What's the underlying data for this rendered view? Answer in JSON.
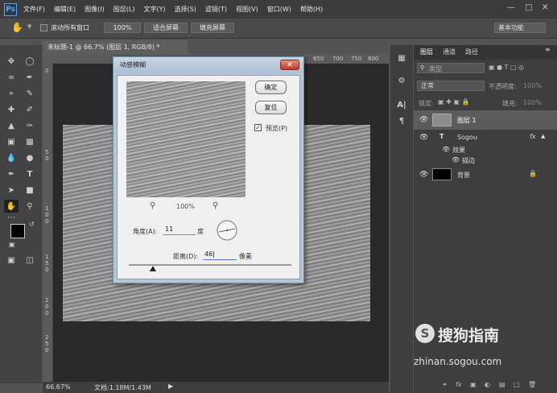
{
  "app": {
    "logo": "Ps"
  },
  "menu": [
    "文件(F)",
    "编辑(E)",
    "图像(I)",
    "图层(L)",
    "文字(Y)",
    "选择(S)",
    "滤镜(T)",
    "视图(V)",
    "窗口(W)",
    "帮助(H)"
  ],
  "options": {
    "scroll_all_label": "滚动所有窗口",
    "zoom_value": "100%",
    "fit_screen": "适合屏幕",
    "fill_screen": "填充屏幕",
    "workspace": "基本功能"
  },
  "document": {
    "tab_title": "未标题-1 @ 66.7% (图层 1, RGB/8) *",
    "ruler_top": [
      "650",
      "700",
      "750",
      "800",
      "850"
    ],
    "ruler_left": [
      "0",
      "5",
      "0",
      "1",
      "0",
      "0",
      "1",
      "5",
      "0",
      "2",
      "0",
      "0",
      "2",
      "5",
      "0",
      "3",
      "0",
      "0"
    ],
    "zoom": "66.67%",
    "doc_info": "文档:1.18M/1.43M"
  },
  "dialog": {
    "title": "动感模糊",
    "ok": "确定",
    "reset": "复位",
    "preview_label": "预览(P)",
    "preview_checked": true,
    "zoom_level": "100%",
    "angle_label": "角度(A):",
    "angle_value": "11",
    "angle_unit": "度",
    "distance_label": "距离(D):",
    "distance_value": "46",
    "distance_unit": "像素",
    "slider_fraction": 0.15
  },
  "panel": {
    "tabs": [
      "图层",
      "通道",
      "路径"
    ],
    "search_placeholder": "类型",
    "blend_mode": "正常",
    "opacity_label": "不透明度:",
    "opacity_value": "100%",
    "lock_label": "锁定:",
    "fill_label": "填充:",
    "fill_value": "100%",
    "layers": [
      {
        "name": "图层 1",
        "selected": true
      },
      {
        "name": "Sogou",
        "type": "text",
        "fx": "fx"
      },
      {
        "name": "效果"
      },
      {
        "name": "描边"
      },
      {
        "name": "背景"
      }
    ]
  },
  "watermark": {
    "brand": "搜狗指南",
    "url": "zhinan.sogou.com"
  }
}
